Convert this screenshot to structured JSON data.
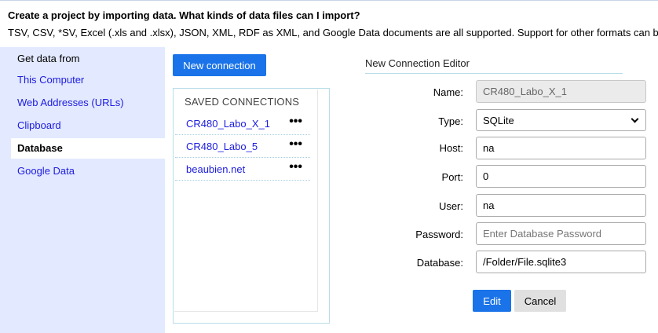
{
  "header": {
    "question": "Create a project by importing data. What kinds of data files can I import?",
    "answer": "TSV, CSV, *SV, Excel (.xls and .xlsx), JSON, XML, RDF as XML, and Google Data documents are all supported. Support for other formats can be added with OpenRefine extensions."
  },
  "sidebar": {
    "heading": "Get data from",
    "items": [
      {
        "label": "This Computer",
        "active": false
      },
      {
        "label": "Web Addresses (URLs)",
        "active": false
      },
      {
        "label": "Clipboard",
        "active": false
      },
      {
        "label": "Database",
        "active": true
      },
      {
        "label": "Google Data",
        "active": false
      }
    ]
  },
  "connections": {
    "new_button": "New connection",
    "title": "SAVED CONNECTIONS",
    "items": [
      {
        "name": "CR480_Labo_X_1",
        "more": "•••"
      },
      {
        "name": "CR480_Labo_5",
        "more": "•••"
      },
      {
        "name": "beaubien.net",
        "more": "•••"
      }
    ]
  },
  "editor": {
    "title": "New Connection Editor",
    "name_label": "Name:",
    "name_value": "CR480_Labo_X_1",
    "type_label": "Type:",
    "type_value": "SQLite",
    "host_label": "Host:",
    "host_value": "na",
    "port_label": "Port:",
    "port_value": "0",
    "user_label": "User:",
    "user_value": "na",
    "password_label": "Password:",
    "password_placeholder": "Enter Database Password",
    "database_label": "Database:",
    "database_value": "/Folder/File.sqlite3",
    "edit_button": "Edit",
    "cancel_button": "Cancel"
  },
  "colors": {
    "accent": "#1a73e8",
    "sidebar_bg": "#e3e9ff",
    "link": "#1c1ce0"
  }
}
